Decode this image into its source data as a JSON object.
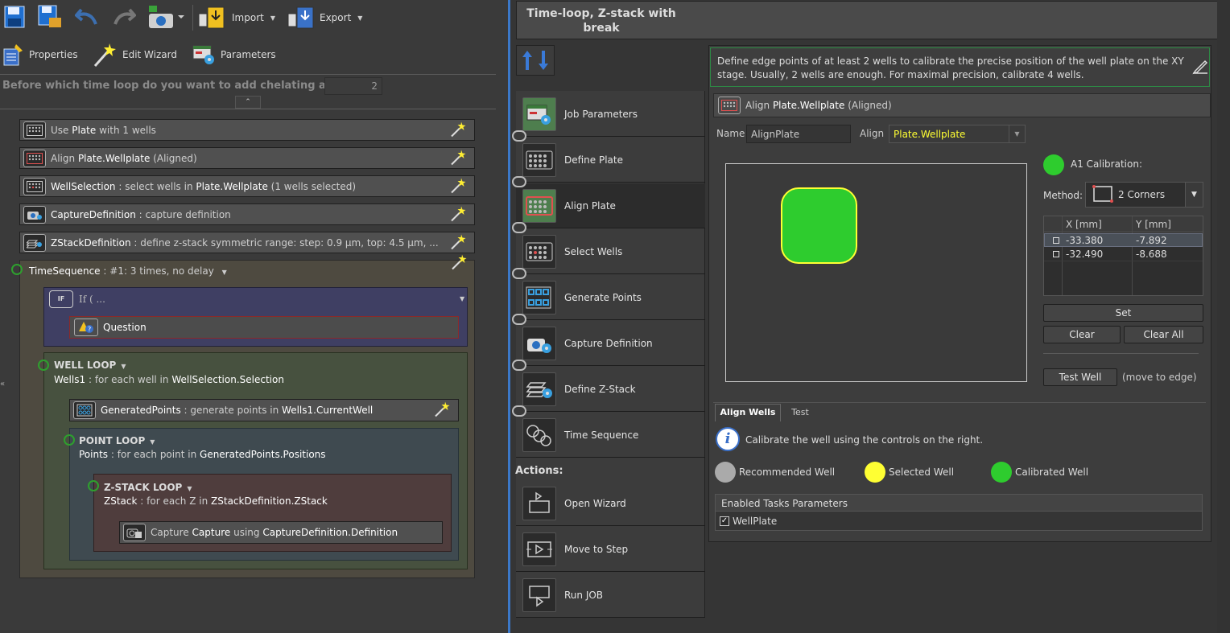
{
  "toolbar": {
    "import_label": "Import",
    "export_label": "Export",
    "properties_label": "Properties",
    "edit_wizard_label": "Edit Wizard",
    "parameters_label": "Parameters"
  },
  "question": {
    "label": "Before which time loop do you want to add chelating agent ?:",
    "value": "2"
  },
  "tasks": [
    {
      "name": "Use",
      "hl": "Plate",
      "rest": "with 1 wells"
    },
    {
      "name": "Align",
      "hl": "Plate.Wellplate",
      "rest": "(Aligned)"
    },
    {
      "name": "WellSelection",
      "sep": ":",
      "rest1": "select wells in",
      "hl": "Plate.Wellplate",
      "rest": "(1 wells selected)"
    },
    {
      "name": "CaptureDefinition",
      "sep": ":",
      "rest": "capture definition"
    },
    {
      "name": "ZStackDefinition",
      "sep": ":",
      "rest": "define z-stack symmetric range: step: 0.9 µm, top: 4.5 µm, ..."
    }
  ],
  "time_sequence": {
    "name": "TimeSequence",
    "sep": ":",
    "rest": "#1: 3 times, no delay"
  },
  "if_block": {
    "badge": "IF",
    "text": "If ( ...",
    "question": "Question"
  },
  "well_loop": {
    "title": "WELL LOOP",
    "var": "Wells1",
    "sep": ":",
    "t1": "for each well in",
    "hl": "WellSelection.Selection"
  },
  "generated_points": {
    "name": "GeneratedPoints",
    "sep": ":",
    "t1": "generate points in",
    "hl": "Wells1.CurrentWell"
  },
  "point_loop": {
    "title": "POINT LOOP",
    "var": "Points",
    "sep": ":",
    "t1": "for each point in",
    "hl": "GeneratedPoints.Positions"
  },
  "zstack_loop": {
    "title": "Z-STACK LOOP",
    "var": "ZStack",
    "sep": ":",
    "t1": "for each Z in",
    "hl": "ZStackDefinition.ZStack"
  },
  "capture": {
    "t0": "Capture",
    "name": "Capture",
    "t1": "using",
    "hl": "CaptureDefinition.Definition"
  },
  "wizard_title": "Time-loop, Z-stack with break",
  "steps": [
    "Job Parameters",
    "Define Plate",
    "Align Plate",
    "Select Wells",
    "Generate Points",
    "Capture Definition",
    "Define Z-Stack",
    "Time Sequence"
  ],
  "actions_label": "Actions:",
  "actions": [
    "Open Wizard",
    "Move to Step",
    "Run JOB"
  ],
  "info_text": "Define edge points of at least 2 wells to calibrate the precise position of the well plate on the XY stage. Usually, 2 wells are enough. For maximal precision, calibrate 4 wells.",
  "align_header": {
    "t0": "Align",
    "hl": "Plate.Wellplate",
    "t1": "(Aligned)"
  },
  "name_label": "Name",
  "name_value": "AlignPlate",
  "align_label": "Align",
  "align_value": "Plate.Wellplate",
  "calibration_label": "A1 Calibration:",
  "method_label": "Method:",
  "method_value": "2 Corners",
  "coords": {
    "headers": [
      "X [mm]",
      "Y [mm]"
    ],
    "rows": [
      [
        "-33.380",
        "-7.892"
      ],
      [
        "-32.490",
        "-8.688"
      ]
    ]
  },
  "buttons": {
    "set": "Set",
    "clear": "Clear",
    "clear_all": "Clear All",
    "test_well": "Test Well",
    "move_to_edge": "(move to edge)"
  },
  "tabs": [
    "Align Wells",
    "Test"
  ],
  "calibrate_text": "Calibrate the well using the controls on the right.",
  "legend": [
    "Recommended Well",
    "Selected Well",
    "Calibrated Well"
  ],
  "enabled_tasks": {
    "title": "Enabled Tasks Parameters",
    "item": "WellPlate"
  },
  "colors": {
    "accent_yellow": "#ffff33",
    "calibrated_green": "#2ecc2e",
    "recommended_gray": "#aaaaaa",
    "info_border": "#2d8a45"
  }
}
